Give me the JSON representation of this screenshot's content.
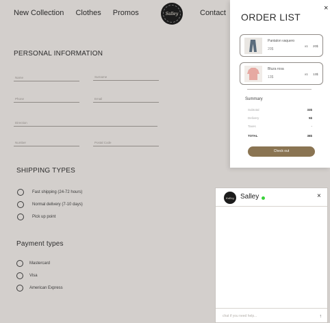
{
  "nav": {
    "new_collection": "New Collection",
    "clothes": "Clothes",
    "promos": "Promos",
    "contact": "Contact"
  },
  "logo": {
    "text": "Salley"
  },
  "personal": {
    "title": "PERSONAL INFORMATION",
    "name_placeholder": "Name",
    "surname_placeholder": "Surname",
    "phone_placeholder": "Phone",
    "email_placeholder": "Email",
    "direction_placeholder": "Direction",
    "number_placeholder": "Number",
    "postal_placeholder": "Postal Code"
  },
  "shipping": {
    "title": "SHIPPING TYPES",
    "options": [
      "Fast shipping (24-72 hours)",
      "Normal delivery (7-10 days)",
      "Pick up point"
    ]
  },
  "payment": {
    "title": "Payment types",
    "options": [
      "Mastercard",
      "Visa",
      "American Express"
    ]
  },
  "order": {
    "title": "ORDER LIST",
    "close": "×",
    "items": [
      {
        "name": "Pantalon vaquero",
        "price": "20$",
        "qty": "x1",
        "total": "20$",
        "color": "#5b6c7c"
      },
      {
        "name": "Bluza rosa",
        "price": "13$",
        "qty": "x1",
        "total": "13$",
        "color": "#e6a9a2"
      }
    ],
    "summary_title": "Summary",
    "subtotal_label": "Subtotal",
    "subtotal_value": "33$",
    "delivery_label": "Delivery",
    "delivery_value": "5$",
    "taxes_label": "Taxes",
    "taxes_value": "-",
    "total_label": "TOTAL",
    "total_value": "38$",
    "checkout": "Check out"
  },
  "chat": {
    "name": "Salley",
    "close": "×",
    "placeholder": "chat if you need help...",
    "send": "↑"
  },
  "colors": {
    "accent": "#8a7452",
    "online": "#39d13a",
    "background": "#d3cfcc"
  }
}
